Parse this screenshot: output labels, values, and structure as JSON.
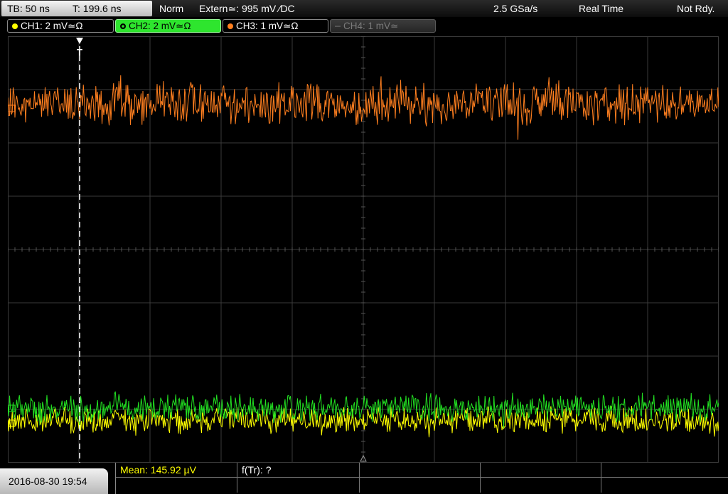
{
  "topbar": {
    "timebase": "TB: 50 ns",
    "trigger_time": "T: 199.6 ns",
    "mode": "Norm",
    "trigger_source": "Extern≃: 995 mV ∕DC",
    "sample_rate": "2.5 GSa/s",
    "acq_mode": "Real Time",
    "status": "Not Rdy."
  },
  "channels": [
    {
      "label": "CH1: 2 mV≃Ω",
      "color": "#ffff00",
      "active": false
    },
    {
      "label": "CH2: 2 mV≃Ω",
      "color": "#2ee52e",
      "active": true
    },
    {
      "label": "CH3: 1 mV≃Ω",
      "color": "#ff7f1f",
      "active": false
    },
    {
      "label": "CH4: 1 mV≃",
      "color": "#7a7a7a",
      "active": false
    }
  ],
  "trigger_marker": "T",
  "bottom": {
    "datetime": "2016-08-30 19:54",
    "measurements": [
      {
        "label": "Mean: 145.92 µV",
        "color": "#ffff00"
      },
      {
        "label": "f(Tr): ?",
        "color": "#ffffff"
      }
    ]
  },
  "colors": {
    "grid": "#3a3a3a",
    "ch1": "#ffff00",
    "ch2": "#22e022",
    "ch3": "#ff7f1f"
  }
}
